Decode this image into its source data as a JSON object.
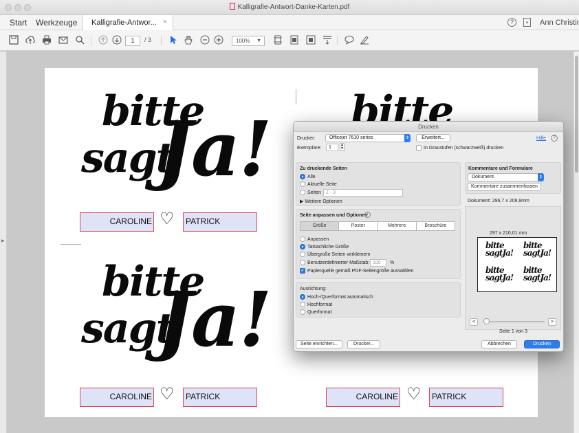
{
  "window": {
    "title": "Kalligrafie-Antwort-Danke-Karten.pdf"
  },
  "tabbar": {
    "start_label": "Start",
    "tools_label": "Werkzeuge",
    "doc_tab_label": "Kalligrafie-Antwor...",
    "doc_tab_close": "×",
    "help_glyph": "?",
    "user_name": "Ann Christin"
  },
  "toolbar": {
    "icons": [
      "save-icon",
      "upload-icon",
      "print-icon",
      "mail-icon",
      "search-icon",
      "page-up-icon",
      "page-down-icon",
      "select-pointer-icon",
      "hand-icon",
      "zoom-out-icon",
      "zoom-in-icon",
      "fit-icon",
      "page-view-icon",
      "fullscreen-icon",
      "scroll-icon",
      "comment-icon",
      "sign-icon"
    ],
    "current_page": "1",
    "total_pages": "/ 3",
    "zoom": "100%"
  },
  "card": {
    "line1": "bitte",
    "line2": "sagt",
    "line3": "Ja!",
    "name_left": "CAROLINE",
    "name_right": "PATRICK",
    "heart": "♡"
  },
  "print_dialog": {
    "title": "Drucken",
    "printer_label": "Drucker:",
    "printer_value": "Officejet 7610 series",
    "advanced_button": "Erweitert...",
    "help_link": "Hilfe",
    "copies_label": "Exemplare:",
    "copies_value": "1",
    "grayscale_label": "In Graustufen (schwarzweiß) drucken",
    "grayscale_checked": false,
    "pages_section_title": "Zu druckende Seiten",
    "pages_options": [
      "Alle",
      "Aktuelle Seite",
      "Seiten"
    ],
    "pages_selected": "Alle",
    "pages_range_placeholder": "1 - 3",
    "more_options_label": "Weitere Optionen",
    "comments_section_title": "Kommentare und Formulare",
    "comments_value": "Dokument",
    "summarize_button": "Kommentare zusammenfassen",
    "document_size": "Dokument: 296,7 x 209,9mm",
    "fit_section_title": "Seite anpassen und Optionen",
    "fit_tabs": [
      "Größe",
      "Poster",
      "Mehrere",
      "Broschüre"
    ],
    "fit_tab_active": "Größe",
    "fit_options": [
      "Anpassen",
      "Tatsächliche Größe",
      "Übergroße Seiten verkleinern",
      "Benutzerdefinierter Maßstab:"
    ],
    "fit_selected": "Tatsächliche Größe",
    "scale_value": "100",
    "scale_unit": "%",
    "paper_source_label": "Papierquelle gemäß PDF-Seitengröße auswählen",
    "paper_source_checked": true,
    "orientation_title": "Ausrichtung:",
    "orientation_options": [
      "Hoch-/Querformat automatisch",
      "Hochformat",
      "Querformat"
    ],
    "orientation_selected": "Hoch-/Querformat automatisch",
    "preview_size": "297 x 210,01 mm",
    "preview_page_text": "Seite 1 von 3",
    "preview_prev": "<",
    "preview_next": ">",
    "page_setup_button": "Seite einrichten...",
    "printer_button": "Drucker...",
    "cancel_button": "Abbrechen",
    "print_button": "Drucken"
  }
}
